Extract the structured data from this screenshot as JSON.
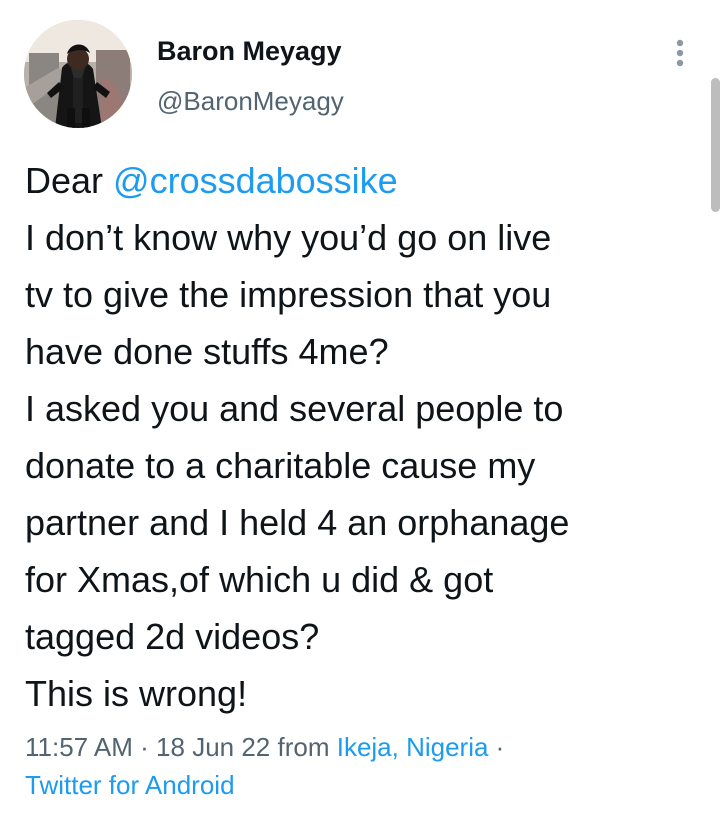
{
  "author": {
    "display_name": "Baron Meyagy",
    "handle": "@BaronMeyagy"
  },
  "tweet": {
    "lines": [
      {
        "prefix": "Dear ",
        "mention": "@crossdabossike"
      },
      {
        "text": "I don’t know why you’d go on live"
      },
      {
        "text": "tv to give the impression that you"
      },
      {
        "text": "have done stuffs 4me?"
      },
      {
        "text": "I asked you and several people to"
      },
      {
        "text": "donate to a charitable cause my"
      },
      {
        "text": "partner and I held 4 an orphanage"
      },
      {
        "text": "for Xmas,of which u did & got"
      },
      {
        "text": "tagged 2d videos?"
      },
      {
        "text": "This is wrong!"
      }
    ]
  },
  "meta": {
    "time": "11:57 AM",
    "separator_1": " · ",
    "date": "18 Jun 22",
    "from_text": " from ",
    "location": "Ikeja, Nigeria",
    "separator_2": " ·",
    "source": "Twitter for Android"
  },
  "icons": {
    "more_icon": "more-vertical-icon"
  },
  "colors": {
    "primary_text": "#0f1419",
    "secondary_text": "#536471",
    "link": "#1d9bf0",
    "background": "#ffffff",
    "scrollbar": "#bdbdbd"
  }
}
